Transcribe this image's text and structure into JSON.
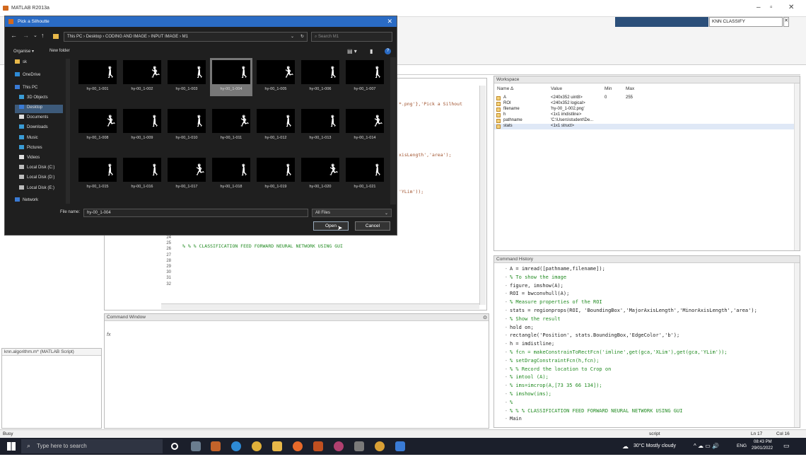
{
  "app": {
    "title": "MATLAB R2013a",
    "search_value": "KNN CLASSIFY"
  },
  "workspace": {
    "header": "Workspace",
    "columns": [
      "Name ∆",
      "Value",
      "Min",
      "Max"
    ],
    "rows": [
      {
        "name": "A",
        "value": "<240x352 uint8>",
        "min": "0",
        "max": "255"
      },
      {
        "name": "ROI",
        "value": "<240x352 logical>",
        "min": "",
        "max": ""
      },
      {
        "name": "filename",
        "value": "'hy-00_1-002.png'",
        "min": "",
        "max": ""
      },
      {
        "name": "h",
        "value": "<1x1 imdistline>",
        "min": "",
        "max": ""
      },
      {
        "name": "pathname",
        "value": "'C:\\Users\\student\\De...",
        "min": "",
        "max": ""
      },
      {
        "name": "stats",
        "value": "<1x1 struct>",
        "min": "",
        "max": ""
      }
    ]
  },
  "history": {
    "header": "Command History",
    "lines": [
      {
        "lead": "",
        "code": "A = imread([pathname,filename]);"
      },
      {
        "lead": "",
        "code": "% To show the image"
      },
      {
        "lead": "",
        "code": "figure, imshow(A);"
      },
      {
        "lead": "",
        "code": "ROI = bwconvhull(A);"
      },
      {
        "lead": "",
        "code": "% Measure properties of the ROI"
      },
      {
        "lead": "",
        "code": "stats = regionprops(ROI, 'BoundingBox','MajorAxisLength','MinorAxisLength','area');"
      },
      {
        "lead": "",
        "code": "% Show the result"
      },
      {
        "lead": "",
        "code": "hold on;"
      },
      {
        "lead": "",
        "code": "rectangle('Position', stats.BoundingBox,'EdgeColor','b');"
      },
      {
        "lead": "",
        "code": "h = imdistline;"
      },
      {
        "lead": "",
        "code": "% fcn = makeConstrainToRectFcn('imline',get(gca,'XLim'),get(gca,'YLim'));"
      },
      {
        "lead": "",
        "code": "% setDragConstraintFcn(h,fcn);"
      },
      {
        "lead": "",
        "code": "% % Record the location to Crop on"
      },
      {
        "lead": "",
        "code": "% imtool (A);"
      },
      {
        "lead": "",
        "code": "% ims=imcrop(A,[73 35 66 134]);"
      },
      {
        "lead": "",
        "code": "% imshow(ims);"
      },
      {
        "lead": "",
        "code": "%"
      },
      {
        "lead": "",
        "code": "%   % % CLASSIFICATION  FEED FORWARD NEURAL NETWORK USING GUI"
      },
      {
        "lead": "",
        "code": "Main"
      }
    ]
  },
  "editor": {
    "line_numbers": [
      "24",
      "25",
      "26",
      "27",
      "28",
      "29",
      "30",
      "31",
      "32"
    ],
    "line25": "% % % CLASSIFICATION  FEED FORWARD NEURAL NETWORK USING GUI",
    "frag1": "*.png'},'Pick a Silhout",
    "frag2": "xisLength','area');",
    "frag3": "'YLim'));"
  },
  "command_window": {
    "header": "Command Window",
    "prompt": "fx"
  },
  "details": {
    "text": "knn.algorithm.m* (MATLAB Script)"
  },
  "statusbar": {
    "left": "Busy",
    "mode": "script",
    "ln": "Ln  17",
    "col": "Col  16"
  },
  "dialog": {
    "title": "Pick a Silhoutte",
    "breadcrumb": [
      "This PC",
      "Desktop",
      "CODING AND IMAGE",
      "INPUT IMAGE",
      "M1"
    ],
    "search_placeholder": "Search M1",
    "organise": "Organise ▾",
    "new_folder": "New folder",
    "nav_items": [
      "sk",
      "OneDrive",
      "This PC",
      "3D Objects",
      "Desktop",
      "Documents",
      "Downloads",
      "Music",
      "Pictures",
      "Videos",
      "Local Disk (C:)",
      "Local Disk (D:)",
      "Local Disk (E:)",
      "Network"
    ],
    "files": [
      "hy-00_1-001",
      "hy-00_1-002",
      "hy-00_1-003",
      "hy-00_1-004",
      "hy-00_1-005",
      "hy-00_1-006",
      "hy-00_1-007",
      "hy-00_1-008",
      "hy-00_1-009",
      "hy-00_1-010",
      "hy-00_1-011",
      "hy-00_1-012",
      "hy-00_1-013",
      "hy-00_1-014",
      "hy-00_1-015",
      "hy-00_1-016",
      "hy-00_1-017",
      "hy-00_1-018",
      "hy-00_1-019",
      "hy-00_1-020",
      "hy-00_1-021"
    ],
    "file_name_label": "File name:",
    "file_name_value": "hy-00_1-004",
    "file_type": "All Files",
    "open_label": "Open",
    "cancel_label": "Cancel",
    "selected_index": 3
  },
  "taskbar": {
    "search_placeholder": "Type here to search",
    "weather": "30°C  Mostly cloudy",
    "lang": "ENG",
    "time": "08:43 PM",
    "date": "29/01/2022"
  }
}
